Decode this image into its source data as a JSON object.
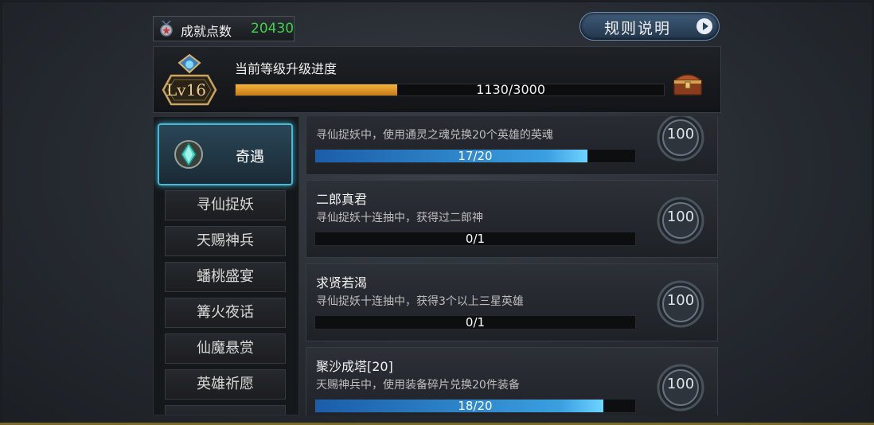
{
  "header": {
    "points_label": "成就点数",
    "points_value": "20430",
    "rules_label": "规则说明"
  },
  "level": {
    "badge": "Lv16",
    "title": "当前等级升级进度",
    "progress_text": "1130/3000",
    "progress": 0.3767
  },
  "sidebar": {
    "active": "奇遇",
    "items": [
      "寻仙捉妖",
      "天赐神兵",
      "蟠桃盛宴",
      "篝火夜话",
      "仙魔悬赏",
      "英雄祈愿"
    ]
  },
  "achievements": [
    {
      "title": "",
      "desc": "寻仙捉妖中，使用通灵之魂兑换20个英雄的英魂",
      "progress_text": "17/20",
      "progress": 0.85,
      "reward": "100"
    },
    {
      "title": "二郎真君",
      "desc": "寻仙捉妖十连抽中，获得过二郎神",
      "progress_text": "0/1",
      "progress": 0,
      "reward": "100"
    },
    {
      "title": "求贤若渴",
      "desc": "寻仙捉妖十连抽中，获得3个以上三星英雄",
      "progress_text": "0/1",
      "progress": 0,
      "reward": "100"
    },
    {
      "title": "聚沙成塔[20]",
      "desc": "天赐神兵中，使用装备碎片兑换20件装备",
      "progress_text": "18/20",
      "progress": 0.9,
      "reward": "100"
    }
  ],
  "colors": {
    "points": "#3fd24a",
    "level_fill": "#e79a26",
    "card_fill": "#3a9fe0",
    "active_border": "#49b8d4"
  }
}
